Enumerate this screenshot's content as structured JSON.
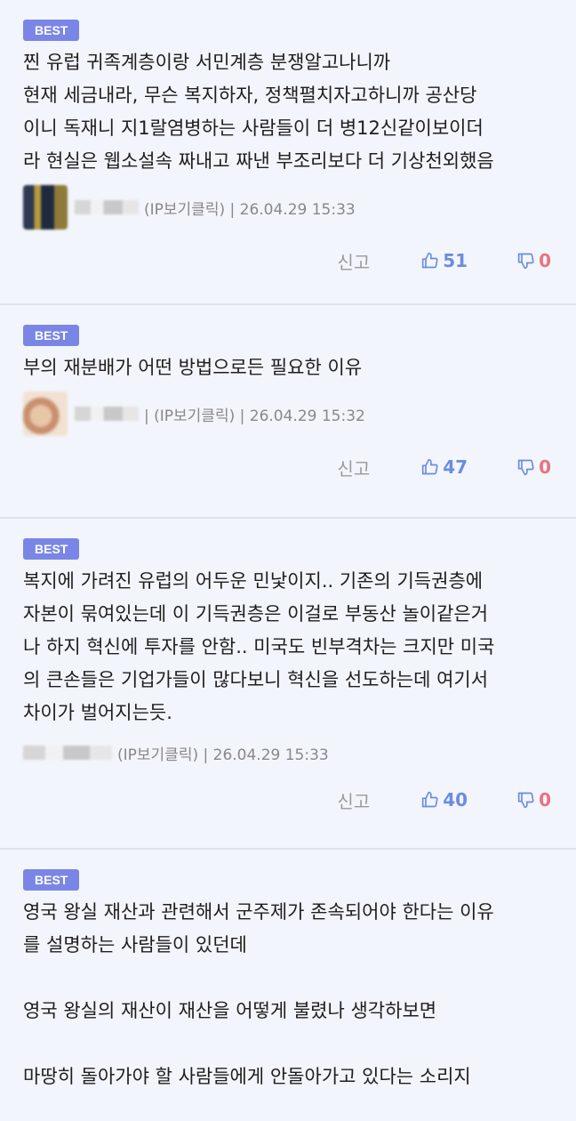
{
  "comments": [
    {
      "badge": "BEST",
      "lines": [
        "찐 유럽 귀족계층이랑 서민계층 분쟁알고나니까",
        "현재 세금내라, 무슨 복지하자, 정책펼치자고하니까 공산당",
        "이니 독재니 지1랄염병하는 사람들이 더 병12신같이보이더",
        "라 현실은 웹소설속 짜내고 짜낸 부조리보다 더 기상천외했음"
      ],
      "meta": "(IP보기클릭) | 26.04.29 15:33",
      "report": "신고",
      "likes": "51",
      "dislikes": "0"
    },
    {
      "badge": "BEST",
      "lines": [
        "부의 재분배가 어떤 방법으로든 필요한 이유"
      ],
      "meta": "| (IP보기클릭) | 26.04.29 15:32",
      "report": "신고",
      "likes": "47",
      "dislikes": "0"
    },
    {
      "badge": "BEST",
      "lines": [
        "복지에 가려진 유럽의 어두운 민낯이지.. 기존의 기득권층에",
        "자본이 묶여있는데 이 기득권층은 이걸로 부동산 놀이같은거",
        "나 하지 혁신에 투자를 안함.. 미국도 빈부격차는 크지만 미국",
        "의 큰손들은 기업가들이 많다보니 혁신을 선도하는데 여기서",
        "차이가 벌어지는듯."
      ],
      "meta": "(IP보기클릭) | 26.04.29 15:33",
      "report": "신고",
      "likes": "40",
      "dislikes": "0"
    },
    {
      "badge": "BEST",
      "lines": [
        "영국 왕실 재산과 관련해서 군주제가 존속되어야 한다는 이유",
        "를 설명하는 사람들이 있던데",
        "",
        "영국 왕실의 재산이 재산을 어떻게 불렸나 생각하보면",
        "",
        "마땅히 돌아가야 할 사람들에게 안돌아가고 있다는 소리지"
      ]
    }
  ]
}
